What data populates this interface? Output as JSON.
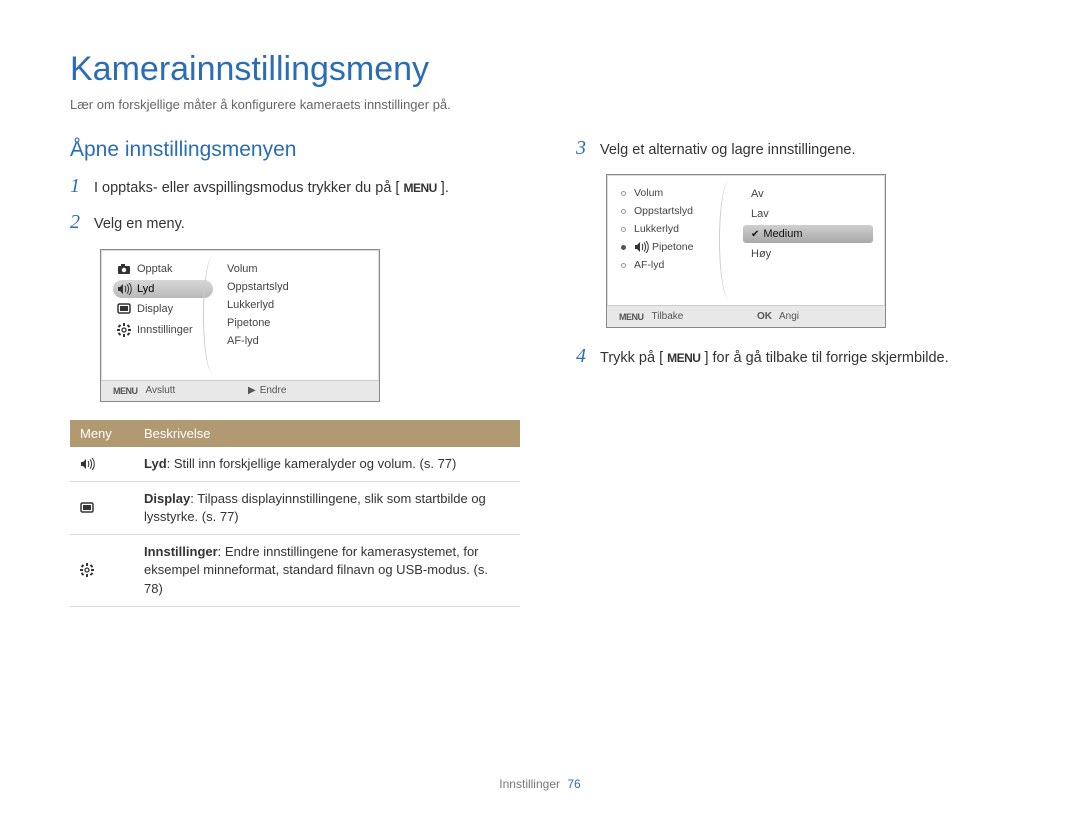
{
  "title": "Kamerainnstillingsmeny",
  "subtitle": "Lær om forskjellige måter å konfigurere kameraets innstillinger på.",
  "section_heading": "Åpne innstillingsmenyen",
  "steps": {
    "s1_pre": "I opptaks- eller avspillingsmodus trykker du på [",
    "s1_badge": "MENU",
    "s1_post": "].",
    "s2": "Velg en meny.",
    "s3": "Velg et alternativ og lagre innstillingene.",
    "s4_pre": "Trykk på [",
    "s4_badge": "MENU",
    "s4_post": "] for å gå tilbake til forrige skjermbilde."
  },
  "lcd1": {
    "left": [
      {
        "icon": "camera",
        "label": "Opptak"
      },
      {
        "icon": "sound",
        "label": "Lyd",
        "selected": true
      },
      {
        "icon": "display",
        "label": "Display"
      },
      {
        "icon": "gear",
        "label": "Innstillinger"
      }
    ],
    "right": [
      "Volum",
      "Oppstartslyd",
      "Lukkerlyd",
      "Pipetone",
      "AF-lyd"
    ],
    "foot_left_badge": "MENU",
    "foot_left": "Avslutt",
    "foot_right_icon": "▶",
    "foot_right": "Endre"
  },
  "lcd2": {
    "left": [
      "Volum",
      "Oppstartslyd",
      "Lukkerlyd",
      "Pipetone",
      "AF-lyd"
    ],
    "left_active_index": 3,
    "right": [
      {
        "label": "Av"
      },
      {
        "label": "Lav"
      },
      {
        "label": "Medium",
        "selected": true,
        "checked": true
      },
      {
        "label": "Høy"
      }
    ],
    "foot_left_badge": "MENU",
    "foot_left": "Tilbake",
    "foot_right_badge": "OK",
    "foot_right": "Angi"
  },
  "table": {
    "head_menu": "Meny",
    "head_desc": "Beskrivelse",
    "rows": [
      {
        "icon": "sound",
        "bold": "Lyd",
        "text": ": Still inn forskjellige kameralyder og volum. (s. 77)"
      },
      {
        "icon": "display",
        "bold": "Display",
        "text": ": Tilpass displayinnstillingene, slik som startbilde og lysstyrke. (s. 77)"
      },
      {
        "icon": "gear",
        "bold": "Innstillinger",
        "text": ": Endre innstillingene for kamerasystemet, for eksempel minneformat, standard filnavn og USB-modus. (s. 78)"
      }
    ]
  },
  "footer": {
    "label": "Innstillinger",
    "page": "76"
  }
}
